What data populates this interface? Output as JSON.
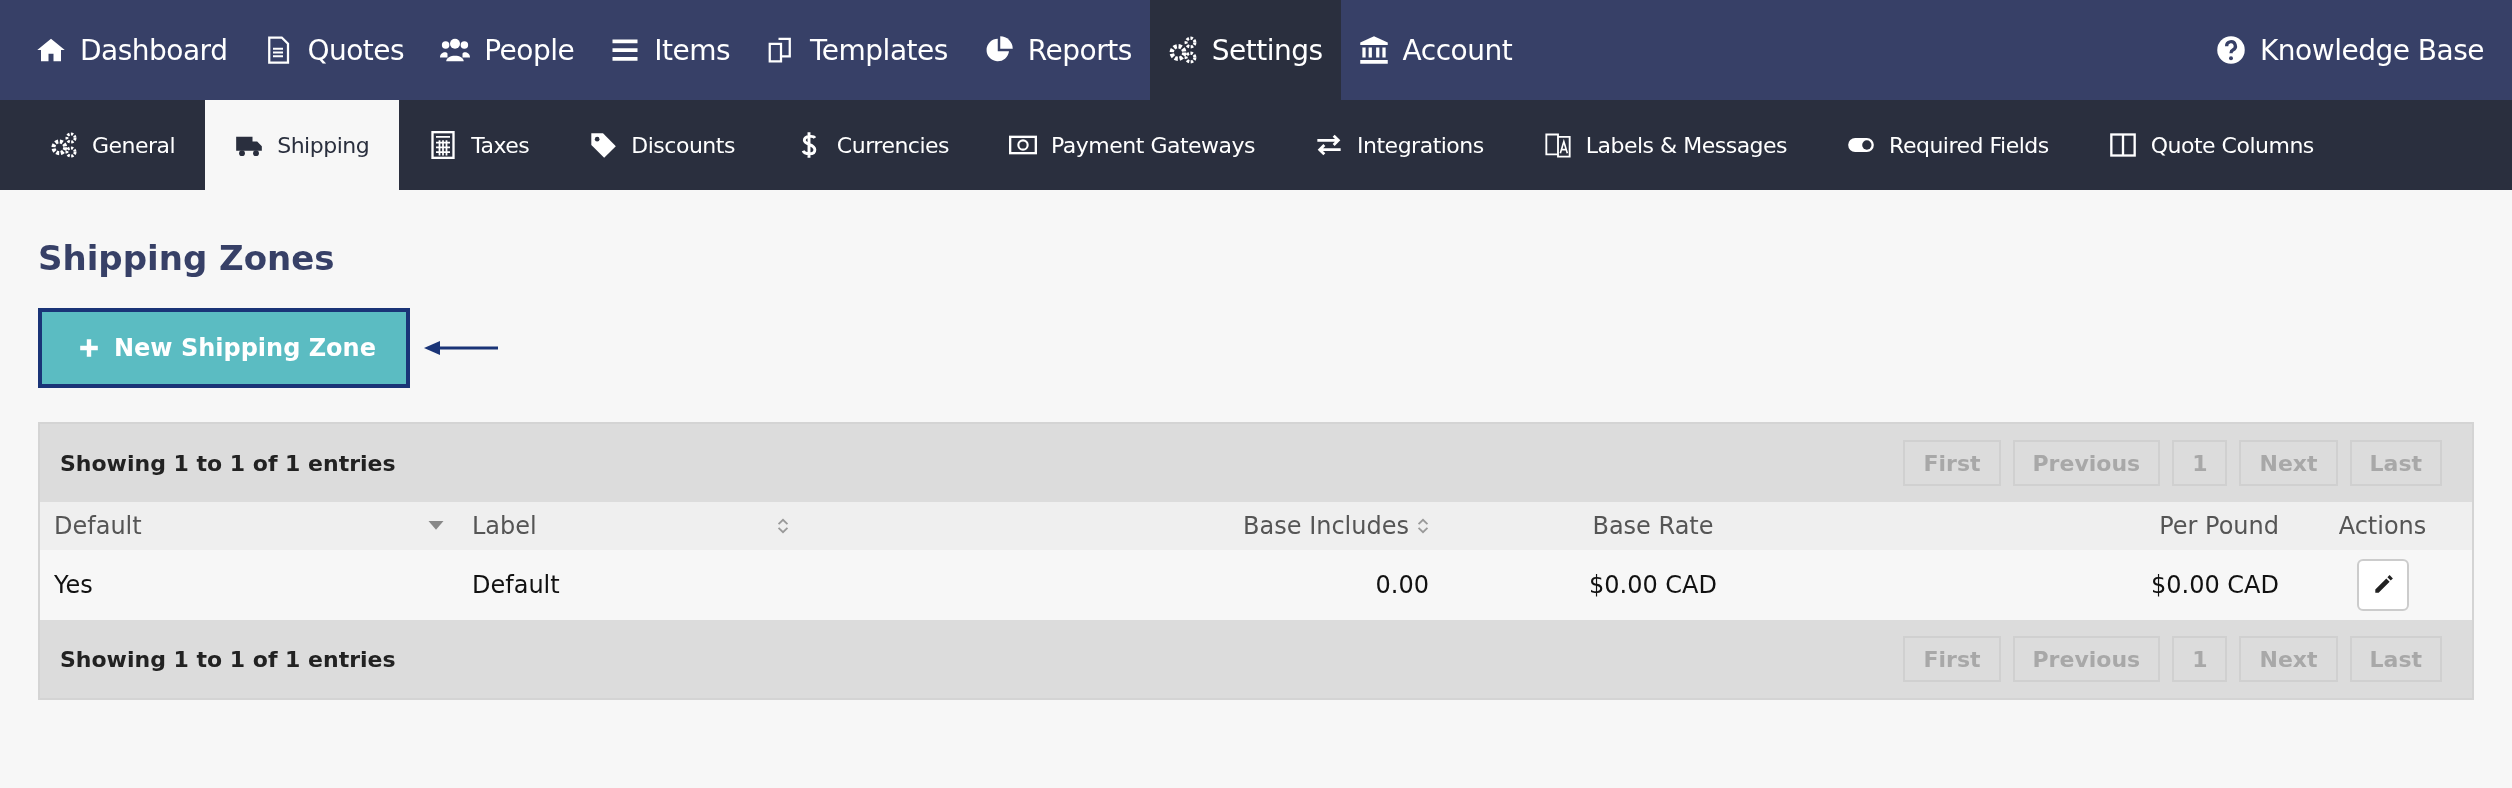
{
  "main_nav": [
    {
      "label": "Dashboard",
      "selected": false
    },
    {
      "label": "Quotes",
      "selected": false
    },
    {
      "label": "People",
      "selected": false
    },
    {
      "label": "Items",
      "selected": false
    },
    {
      "label": "Templates",
      "selected": false
    },
    {
      "label": "Reports",
      "selected": false
    },
    {
      "label": "Settings",
      "selected": true
    },
    {
      "label": "Account",
      "selected": false
    }
  ],
  "help_link": "Knowledge Base",
  "settings_tabs": [
    {
      "label": "General",
      "selected": false
    },
    {
      "label": "Shipping",
      "selected": true
    },
    {
      "label": "Taxes",
      "selected": false
    },
    {
      "label": "Discounts",
      "selected": false
    },
    {
      "label": "Currencies",
      "selected": false
    },
    {
      "label": "Payment Gateways",
      "selected": false
    },
    {
      "label": "Integrations",
      "selected": false
    },
    {
      "label": "Labels & Messages",
      "selected": false
    },
    {
      "label": "Required Fields",
      "selected": false
    },
    {
      "label": "Quote Columns",
      "selected": false
    }
  ],
  "page_title": "Shipping Zones",
  "new_button": "New Shipping Zone",
  "table": {
    "info_top": "Showing 1 to 1 of 1 entries",
    "pagination_top": [
      {
        "label": "First",
        "disabled": true
      },
      {
        "label": "Previous",
        "disabled": true
      },
      {
        "label": "1",
        "disabled": true
      },
      {
        "label": "Next",
        "disabled": true
      },
      {
        "label": "Last",
        "disabled": true
      }
    ],
    "columns": [
      {
        "label": "Default",
        "sorted": true
      },
      {
        "label": "Label",
        "sorted": false
      },
      {
        "label": "Base Includes",
        "sorted": false
      },
      {
        "label": "Base Rate"
      },
      {
        "label": "Per Pound"
      },
      {
        "label": "Actions"
      }
    ],
    "rows": [
      {
        "cells": [
          "Yes",
          "Default",
          "0.00",
          "$0.00 CAD",
          "$0.00 CAD"
        ]
      }
    ],
    "info_bottom": "Showing 1 to 1 of 1 entries",
    "pagination_bottom": [
      {
        "label": "First",
        "disabled": true
      },
      {
        "label": "Previous",
        "disabled": true
      },
      {
        "label": "1",
        "disabled": true
      },
      {
        "label": "Next",
        "disabled": true
      },
      {
        "label": "Last",
        "disabled": true
      }
    ]
  }
}
